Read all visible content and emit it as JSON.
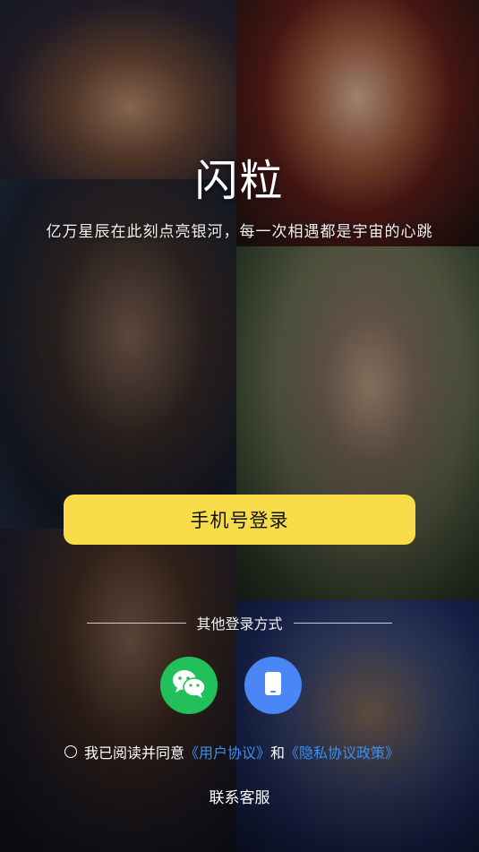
{
  "app": {
    "title": "闪粒",
    "tagline": "亿万星辰在此刻点亮银河，每一次相遇都是宇宙的心跳"
  },
  "login": {
    "phone_label": "手机号登录",
    "other_methods_label": "其他登录方式",
    "methods": [
      {
        "name": "wechat",
        "icon": "wechat-icon",
        "color": "#21c05b"
      },
      {
        "name": "device",
        "icon": "phone-device-icon",
        "color": "#4a86f5"
      }
    ]
  },
  "agreement": {
    "prefix": "我已阅读并同意",
    "user_agreement": "《用户协议》",
    "and": "和",
    "privacy_policy": "《隐私协议政策》",
    "checked": false
  },
  "support": {
    "label": "联系客服"
  },
  "colors": {
    "primary_button": "#f8dc4a",
    "link": "#3a8ff0"
  }
}
